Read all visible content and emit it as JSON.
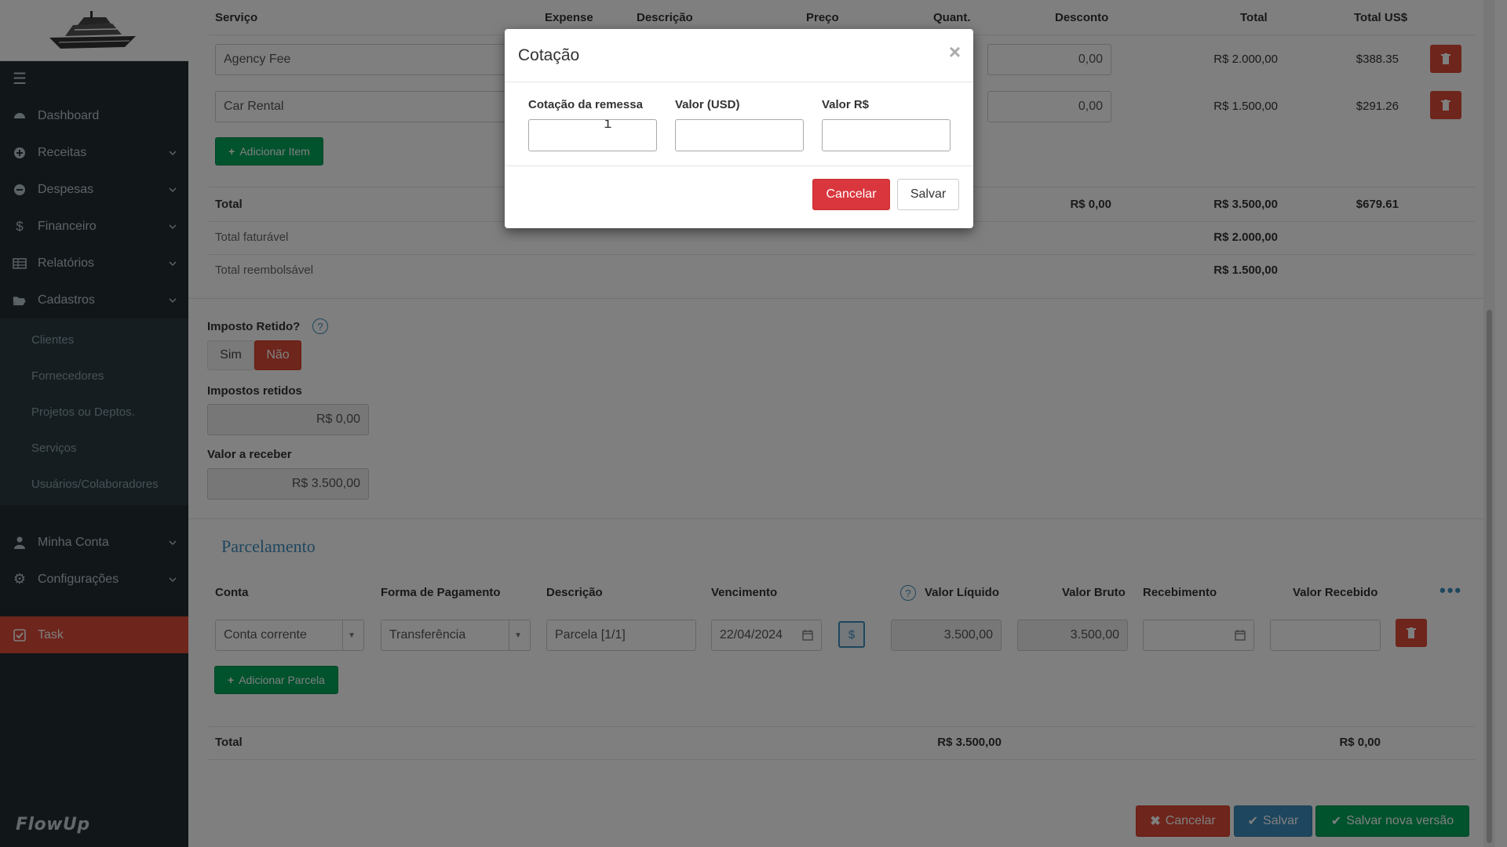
{
  "sidebar": {
    "items": [
      {
        "label": "Dashboard",
        "icon": "dashboard-icon"
      },
      {
        "label": "Receitas",
        "icon": "plus-circle-icon"
      },
      {
        "label": "Despesas",
        "icon": "minus-circle-icon"
      },
      {
        "label": "Financeiro",
        "icon": "dollar-icon"
      },
      {
        "label": "Relatórios",
        "icon": "table-icon"
      },
      {
        "label": "Cadastros",
        "icon": "folder-open-icon"
      }
    ],
    "subitems": [
      "Clientes",
      "Fornecedores",
      "Projetos ou Deptos.",
      "Serviços",
      "Usuários/Colaboradores"
    ],
    "lower_items": [
      {
        "label": "Minha Conta",
        "icon": "user-icon"
      },
      {
        "label": "Configurações",
        "icon": "cogs-icon"
      }
    ],
    "task_label": "Task",
    "brand": "FlowUp"
  },
  "services_table": {
    "headers": {
      "servico": "Serviço",
      "expense": "Expense",
      "descricao": "Descrição",
      "preco": "Preço",
      "quant": "Quant.",
      "desconto": "Desconto",
      "total": "Total",
      "total_usd": "Total US$"
    },
    "rows": [
      {
        "servico": "Agency Fee",
        "desconto": "0,00",
        "total": "R$ 2.000,00",
        "total_usd": "$388.35"
      },
      {
        "servico": "Car Rental",
        "desconto": "0,00",
        "total": "R$ 1.500,00",
        "total_usd": "$291.26"
      }
    ],
    "add_item_label": "Adicionar Item",
    "total_label": "Total",
    "total_desconto": "R$ 0,00",
    "total_value": "R$ 3.500,00",
    "total_usd": "$679.61",
    "faturavel_label": "Total faturável",
    "faturavel_value": "R$ 2.000,00",
    "reembolsavel_label": "Total reembolsável",
    "reembolsavel_value": "R$ 1.500,00"
  },
  "tax": {
    "question": "Imposto Retido?",
    "sim": "Sim",
    "nao": "Não",
    "retidos_label": "Impostos retidos",
    "retidos_value": "R$ 0,00",
    "receber_label": "Valor a receber",
    "receber_value": "R$ 3.500,00"
  },
  "parcelamento": {
    "title": "Parcelamento",
    "headers": {
      "conta": "Conta",
      "forma": "Forma de Pagamento",
      "descricao": "Descrição",
      "vencimento": "Vencimento",
      "liquido": "Valor Líquido",
      "bruto": "Valor Bruto",
      "recebimento": "Recebimento",
      "recebido": "Valor Recebido"
    },
    "row": {
      "conta": "Conta corrente",
      "forma": "Transferência",
      "descricao": "Parcela [1/1]",
      "vencimento": "22/04/2024",
      "liquido": "3.500,00",
      "bruto": "3.500,00"
    },
    "add_label": "Adicionar Parcela",
    "total_label": "Total",
    "total_value": "R$ 3.500,00",
    "total_recebido": "R$ 0,00"
  },
  "footer": {
    "cancel": "Cancelar",
    "save": "Salvar",
    "save_new": "Salvar nova versão"
  },
  "modal": {
    "title": "Cotação",
    "field1_label": "Cotação da remessa",
    "field2_label": "Valor (USD)",
    "field3_label": "Valor R$",
    "cancel": "Cancelar",
    "save": "Salvar"
  },
  "colors": {
    "sidebar_bg": "#222d32",
    "accent_red": "#dd4b39",
    "accent_green": "#00a65a",
    "accent_blue": "#3c8dbc"
  }
}
